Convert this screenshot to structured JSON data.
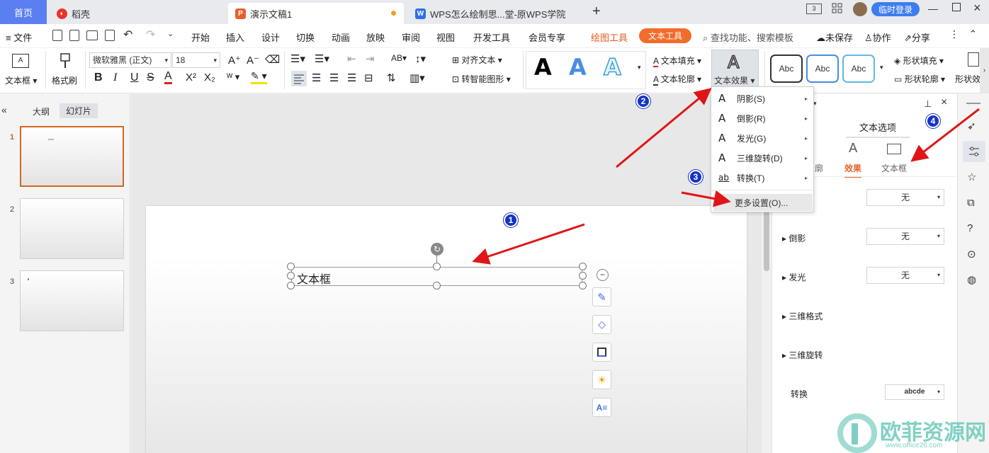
{
  "tabs": {
    "home": "首页",
    "daoke": "稻壳",
    "doc": "演示文稿1",
    "wps": "WPS怎么绘制思...堂-原WPS学院",
    "login": "临时登录"
  },
  "menubar": {
    "file": "文件",
    "items": [
      "开始",
      "插入",
      "设计",
      "切换",
      "动画",
      "放映",
      "审阅",
      "视图",
      "开发工具",
      "会员专享"
    ],
    "draw_tools": "绘图工具",
    "text_tools": "文本工具",
    "search": "查找功能、搜索模板",
    "unsaved": "未保存",
    "collab": "协作",
    "share": "分享"
  },
  "ribbon": {
    "textbox": "文本框",
    "format_painter": "格式刷",
    "font_name": "微软雅黑 (正文)",
    "font_size": "18",
    "align_text": "对齐文本",
    "smart_shape": "转智能图形",
    "text_fill": "文本填充",
    "text_outline": "文本轮廓",
    "text_effect": "文本效果",
    "abc": "Abc",
    "shape_fill": "形状填充",
    "shape_outline": "形状轮廓",
    "shape_more": "形状效",
    "big_a": "A"
  },
  "leftpanel": {
    "outline": "大纲",
    "slides": "幻灯片",
    "nums": [
      "1",
      "2",
      "3"
    ]
  },
  "slide": {
    "textbox_text": "文本框"
  },
  "effect_menu": {
    "items": [
      {
        "label": "阴影(S)",
        "icon": "A"
      },
      {
        "label": "倒影(R)",
        "icon": "A"
      },
      {
        "label": "发光(G)",
        "icon": "A"
      },
      {
        "label": "三维旋转(D)",
        "icon": "A"
      },
      {
        "label": "转换(T)",
        "icon": "ab"
      }
    ],
    "more": "更多设置(O)..."
  },
  "rightpanel": {
    "tab_prev": "选项",
    "tab_text": "文本选项",
    "sub_outline": "轮廓",
    "sub_effect": "效果",
    "sub_textbox": "文本框",
    "rows": [
      {
        "label": "倒影",
        "value": "无"
      },
      {
        "label": "发光",
        "value": "无"
      },
      {
        "label": "三维格式",
        "value": ""
      },
      {
        "label": "三维旋转",
        "value": ""
      }
    ],
    "first_value": "无",
    "transform_label": "转换",
    "transform_value": "abcde"
  },
  "badges": [
    "1",
    "2",
    "3",
    "4"
  ],
  "watermark": {
    "name": "欧菲资源网",
    "url": "www.office26.com"
  },
  "colors": {
    "accent": "#f26c2c",
    "blue": "#3d7df0",
    "badge": "#1533c6",
    "arrow": "#e01515"
  }
}
